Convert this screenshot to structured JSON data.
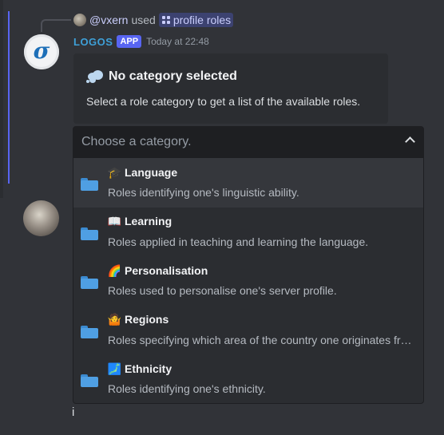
{
  "reply": {
    "username": "@vxern",
    "used_text": "used",
    "command": "profile roles"
  },
  "bot": {
    "avatar_glyph": "σ",
    "name": "LOGOS",
    "badge": "APP",
    "timestamp": "Today at 22:48"
  },
  "embed": {
    "title": "No category selected",
    "description": "Select a role category to get a list of the available roles."
  },
  "select": {
    "placeholder": "Choose a category.",
    "options": [
      {
        "emoji": "🎓",
        "label": "Language",
        "description": "Roles identifying one's linguistic ability."
      },
      {
        "emoji": "📖",
        "label": "Learning",
        "description": "Roles applied in teaching and learning the language."
      },
      {
        "emoji": "🌈",
        "label": "Personalisation",
        "description": "Roles used to personalise one's server profile."
      },
      {
        "emoji": "🤷",
        "label": "Regions",
        "description": "Roles specifying which area of the country one originates from."
      },
      {
        "emoji": "🗾",
        "label": "Ethnicity",
        "description": "Roles identifying one's ethnicity."
      }
    ]
  },
  "composer": {
    "text": "i"
  },
  "colors": {
    "background": "#313338",
    "accent": "#5865f2",
    "bot_name": "#3ea0d8",
    "folder": "#4f9fe3"
  }
}
